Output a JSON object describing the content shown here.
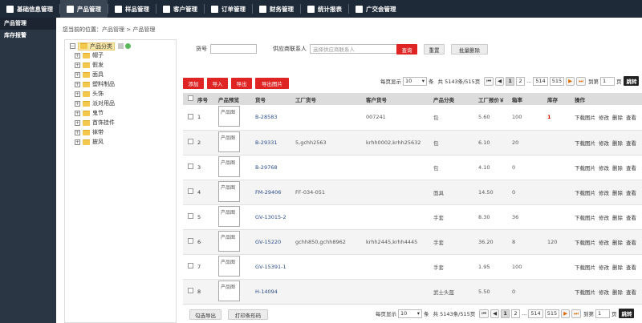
{
  "nav": {
    "items": [
      {
        "label": "基础信息管理",
        "active": false
      },
      {
        "label": "产品管理",
        "active": true
      },
      {
        "label": "样品管理",
        "active": false
      },
      {
        "label": "客户管理",
        "active": false
      },
      {
        "label": "订单管理",
        "active": false
      },
      {
        "label": "财务管理",
        "active": false
      },
      {
        "label": "统计报表",
        "active": false
      },
      {
        "label": "广交会管理",
        "active": false
      }
    ]
  },
  "sidebar": {
    "items": [
      {
        "label": "产品管理",
        "active": true
      },
      {
        "label": "库存报警",
        "active": false
      }
    ]
  },
  "breadcrumb": {
    "prefix": "您当前的位置：",
    "path": "产品管理 > 产品管理"
  },
  "tree": {
    "root": "产品分类",
    "children": [
      "帽子",
      "假发",
      "面具",
      "塑料制品",
      "头饰",
      "派对用品",
      "鬼节",
      "首饰挂件",
      "袜带",
      "披风"
    ]
  },
  "filter": {
    "sku_label": "货号",
    "sku_value": "",
    "supplier_label": "供应商联系人",
    "supplier_placeholder": "选择供应商联系人",
    "search_btn": "查询",
    "reset_btn": "重置",
    "batch_delete_btn": "批量删除"
  },
  "toolbar": {
    "add": "添加",
    "import": "导入",
    "export": "导出",
    "export_images": "导出图片"
  },
  "pager": {
    "per_page_label": "每页显示",
    "per_page_value": "10",
    "unit": "条",
    "total_text": "共 5143条/515页",
    "pages": [
      "1",
      "2",
      "...",
      "514",
      "515"
    ],
    "goto_label": "到第",
    "goto_value": "1",
    "goto_unit": "页",
    "jump_btn": "跳转"
  },
  "table": {
    "headers": [
      "序号",
      "产品预览",
      "货号",
      "工厂货号",
      "客户货号",
      "产品分类",
      "工厂报价￥",
      "箱率",
      "库存",
      "操作"
    ],
    "rows": [
      {
        "no": "1",
        "sku": "B-28583",
        "factory_sku": "",
        "customer_sku": "007241",
        "category": "包",
        "price": "5.60",
        "box_rate": "100",
        "stock": "1",
        "stock_red": true
      },
      {
        "no": "2",
        "sku": "B-29331",
        "factory_sku": "5,gchh2563",
        "customer_sku": "krhh0002,krhh25632",
        "category": "包",
        "price": "6.10",
        "box_rate": "20",
        "stock": "",
        "stock_red": false
      },
      {
        "no": "3",
        "sku": "B-29768",
        "factory_sku": "",
        "customer_sku": "",
        "category": "包",
        "price": "4.10",
        "box_rate": "0",
        "stock": "",
        "stock_red": false
      },
      {
        "no": "4",
        "sku": "FM-29406",
        "factory_sku": "FF-034-051",
        "customer_sku": "",
        "category": "面具",
        "price": "14.50",
        "box_rate": "0",
        "stock": "",
        "stock_red": false
      },
      {
        "no": "5",
        "sku": "GV-13015-2",
        "factory_sku": "",
        "customer_sku": "",
        "category": "手套",
        "price": "8.30",
        "box_rate": "36",
        "stock": "",
        "stock_red": false
      },
      {
        "no": "6",
        "sku": "GV-15220",
        "factory_sku": "gchh850,gchh8962",
        "customer_sku": "krhh2445,krhh4445",
        "category": "手套",
        "price": "36.20",
        "box_rate": "8",
        "stock": "120",
        "stock_red": false
      },
      {
        "no": "7",
        "sku": "GV-15391-1",
        "factory_sku": "",
        "customer_sku": "",
        "category": "手套",
        "price": "1.95",
        "box_rate": "100",
        "stock": "",
        "stock_red": false
      },
      {
        "no": "8",
        "sku": "H-14094",
        "factory_sku": "",
        "customer_sku": "",
        "category": "武士头盔",
        "price": "5.50",
        "box_rate": "0",
        "stock": "",
        "stock_red": false
      }
    ],
    "thumb_alt": "产品图",
    "actions": {
      "download": "下载图片",
      "edit": "修改",
      "delete": "删除",
      "view": "查看"
    }
  },
  "bottom": {
    "export_selected": "勾选导出",
    "print_barcode": "打印条形码"
  }
}
